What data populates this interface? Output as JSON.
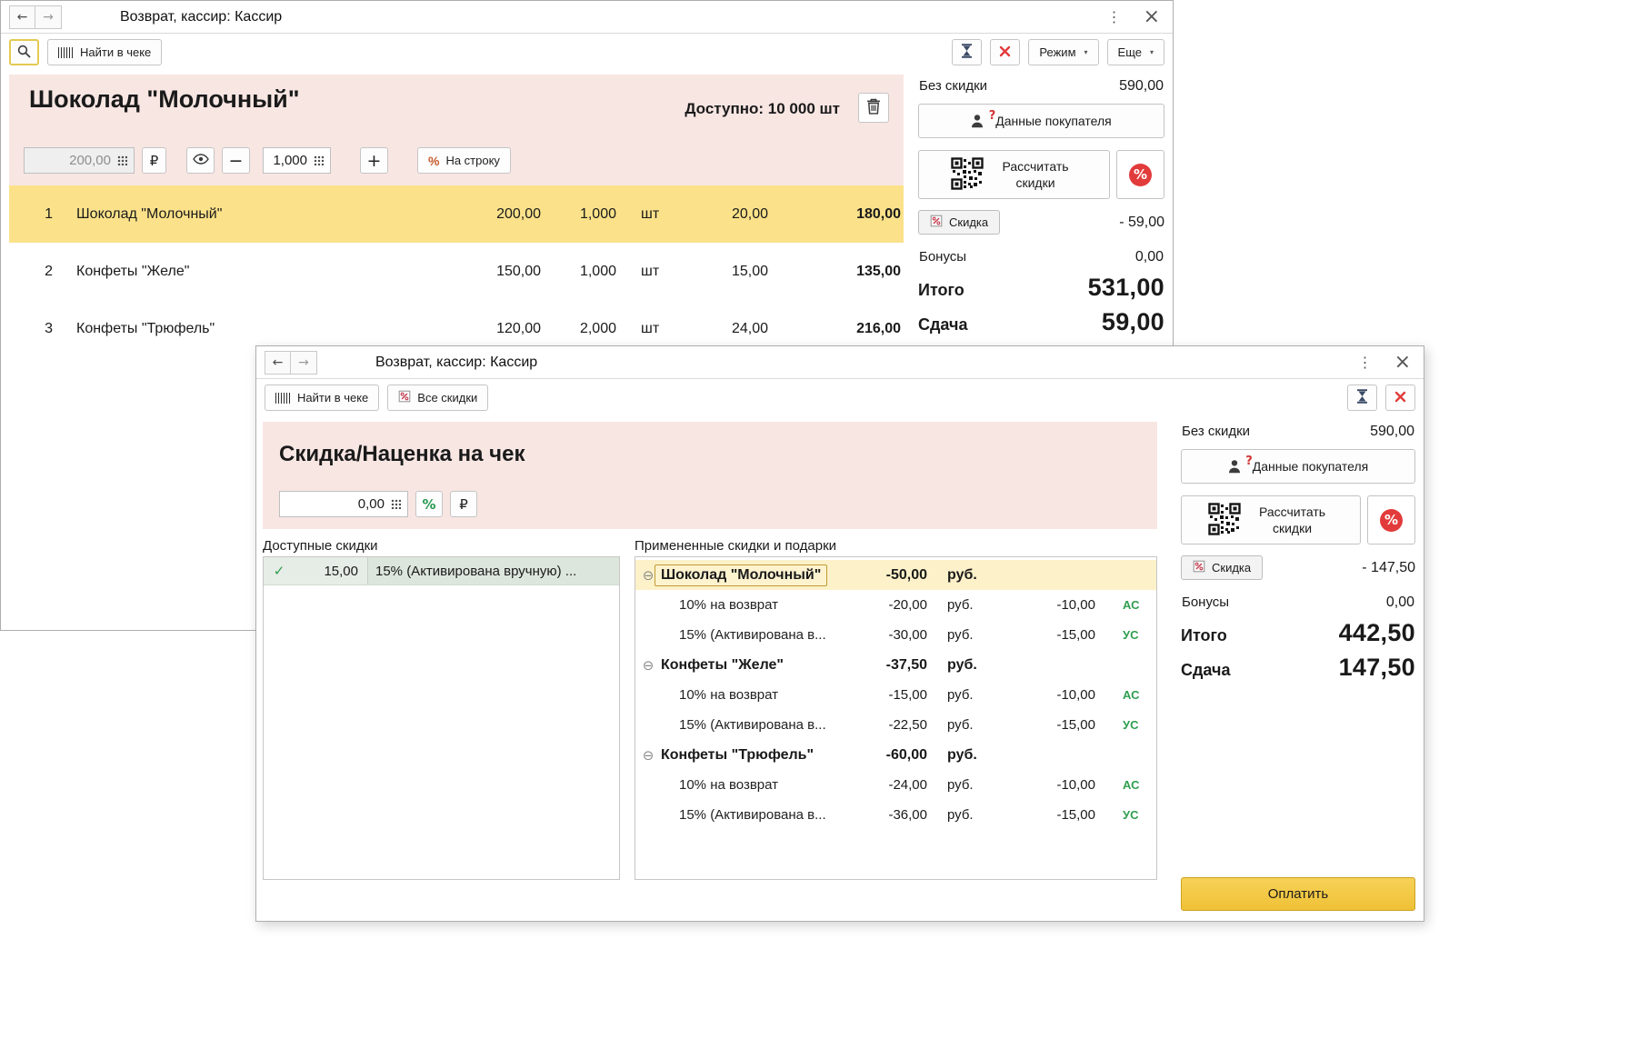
{
  "icons": {
    "back": "←",
    "forward": "→",
    "menu": "⋮",
    "close": "×",
    "caret": "▾",
    "check": "✓",
    "collapse": "⊖",
    "ruble": "₽",
    "percent": "%",
    "question": "?",
    "minus": "−",
    "plus": "+"
  },
  "colors": {
    "accent_yellow": "#efc136",
    "selected_row": "#fbe28a",
    "pink_panel": "#f8e6e3",
    "green": "#2f9e4f",
    "red": "#e23b3b"
  },
  "window1": {
    "title": "Возврат, кассир: Кассир",
    "toolbar": {
      "find_in_receipt": "Найти в чеке",
      "mode": "Режим",
      "more": "Еще"
    },
    "product": {
      "name": "Шоколад \"Молочный\"",
      "available": "Доступно: 10 000 шт",
      "price": "200,00",
      "qty": "1,000",
      "per_line": "На строку"
    },
    "table": {
      "rows": [
        {
          "num": "1",
          "name": "Шоколад \"Молочный\"",
          "price": "200,00",
          "qty": "1,000",
          "unit": "шт",
          "discount": "20,00",
          "total": "180,00"
        },
        {
          "num": "2",
          "name": "Конфеты \"Желе\"",
          "price": "150,00",
          "qty": "1,000",
          "unit": "шт",
          "discount": "15,00",
          "total": "135,00"
        },
        {
          "num": "3",
          "name": "Конфеты \"Трюфель\"",
          "price": "120,00",
          "qty": "2,000",
          "unit": "шт",
          "discount": "24,00",
          "total": "216,00"
        }
      ]
    },
    "sidebar": {
      "no_discount_label": "Без скидки",
      "no_discount_value": "590,00",
      "customer_button": "Данные покупателя",
      "calc_discounts": "Рассчитать скидки",
      "discount_button": "Скидка",
      "discount_value": "- 59,00",
      "bonus_label": "Бонусы",
      "bonus_value": "0,00",
      "total_label": "Итого",
      "total_value": "531,00",
      "change_label": "Сдача",
      "change_value": "59,00"
    }
  },
  "window2": {
    "title": "Возврат, кассир: Кассир",
    "toolbar": {
      "find_in_receipt": "Найти в чеке",
      "all_discounts": "Все скидки"
    },
    "panel": {
      "heading": "Скидка/Наценка на чек",
      "amount": "0,00"
    },
    "available": {
      "label": "Доступные скидки",
      "rows": [
        {
          "value": "15,00",
          "desc": "15% (Активирована вручную) ..."
        }
      ]
    },
    "applied": {
      "label": "Примененные скидки и подарки",
      "groups": [
        {
          "name": "Шоколад \"Молочный\"",
          "amount": "-50,00",
          "currency": "руб.",
          "items": [
            {
              "name": "10% на возврат",
              "amount": "-20,00",
              "currency": "руб.",
              "percent": "-10,00",
              "tag": "АС"
            },
            {
              "name": "15% (Активирована в...",
              "amount": "-30,00",
              "currency": "руб.",
              "percent": "-15,00",
              "tag": "УС"
            }
          ]
        },
        {
          "name": "Конфеты \"Желе\"",
          "amount": "-37,50",
          "currency": "руб.",
          "items": [
            {
              "name": "10% на возврат",
              "amount": "-15,00",
              "currency": "руб.",
              "percent": "-10,00",
              "tag": "АС"
            },
            {
              "name": "15% (Активирована в...",
              "amount": "-22,50",
              "currency": "руб.",
              "percent": "-15,00",
              "tag": "УС"
            }
          ]
        },
        {
          "name": "Конфеты \"Трюфель\"",
          "amount": "-60,00",
          "currency": "руб.",
          "items": [
            {
              "name": "10% на возврат",
              "amount": "-24,00",
              "currency": "руб.",
              "percent": "-10,00",
              "tag": "АС"
            },
            {
              "name": "15% (Активирована в...",
              "amount": "-36,00",
              "currency": "руб.",
              "percent": "-15,00",
              "tag": "УС"
            }
          ]
        }
      ]
    },
    "sidebar": {
      "no_discount_label": "Без скидки",
      "no_discount_value": "590,00",
      "customer_button": "Данные покупателя",
      "calc_discounts": "Рассчитать скидки",
      "discount_button": "Скидка",
      "discount_value": "- 147,50",
      "bonus_label": "Бонусы",
      "bonus_value": "0,00",
      "total_label": "Итого",
      "total_value": "442,50",
      "change_label": "Сдача",
      "change_value": "147,50",
      "pay_button": "Оплатить"
    }
  }
}
